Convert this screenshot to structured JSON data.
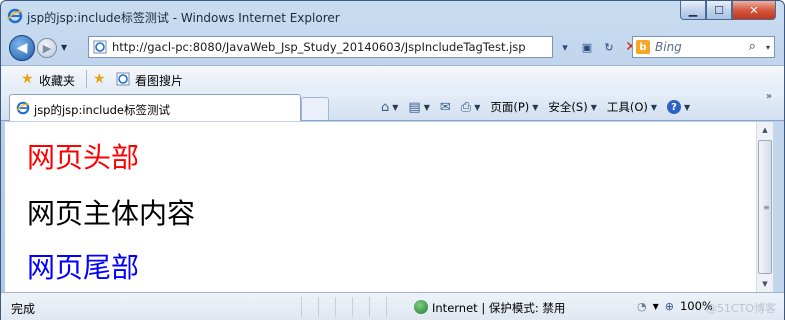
{
  "window": {
    "title": "jsp的jsp:include标签测试 - Windows Internet Explorer",
    "icon": "ie-logo-icon",
    "controls": {
      "minimize": "▁",
      "maximize": "☐",
      "close": "✕"
    }
  },
  "address_bar": {
    "url": "http://gacl-pc:8080/JavaWeb_Jsp_Study_20140603/JspIncludeTagTest.jsp",
    "refresh_icon": "↻",
    "stop_icon": "✕",
    "compat_icon": "▣",
    "dropdown_icon": "▾"
  },
  "search": {
    "placeholder": "Bing",
    "engine_icon": "b",
    "search_icon": "⌕",
    "dropdown_icon": "▾"
  },
  "favorites_bar": {
    "label": "收藏夹",
    "items": [
      {
        "label": "看图搜片"
      }
    ]
  },
  "tab": {
    "label": "jsp的jsp:include标签测试"
  },
  "command_bar": {
    "home_icon": "⌂",
    "feeds_icon": "▤",
    "mail_icon": "✉",
    "print_icon": "⎙",
    "page_label": "页面(P)",
    "safety_label": "安全(S)",
    "tools_label": "工具(O)",
    "help_icon": "?",
    "chevron": "»"
  },
  "content": {
    "header_text": "网页头部",
    "main_text": "网页主体内容",
    "footer_text": "网页尾部",
    "colors": {
      "header": "#ff0000",
      "main": "#000000",
      "footer": "#0000ff"
    }
  },
  "status_bar": {
    "status_text": "完成",
    "zone_text": "Internet | 保护模式: 禁用",
    "zoom_text": "100%",
    "watermark": "@51CTO博客"
  }
}
